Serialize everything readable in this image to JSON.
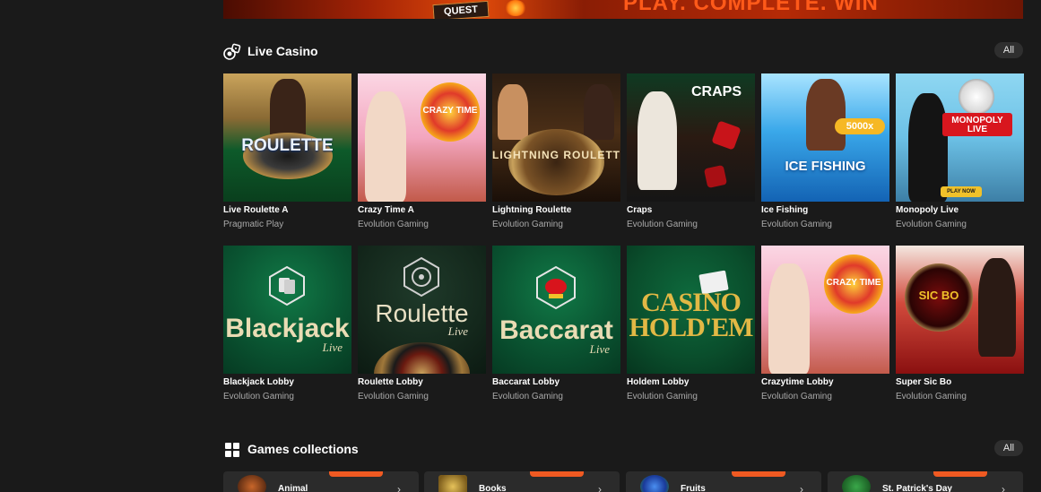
{
  "banner": {
    "badge": "QUEST",
    "slogan": "PLAY. COMPLETE. WIN"
  },
  "live_casino": {
    "title": "Live Casino",
    "icon": "chips-dice-icon",
    "all_label": "All",
    "games": [
      {
        "name": "Live Roulette A",
        "provider": "Pragmatic Play",
        "art": "ROULETTE"
      },
      {
        "name": "Crazy Time A",
        "provider": "Evolution Gaming",
        "art": "CRAZY TIME"
      },
      {
        "name": "Lightning Roulette",
        "provider": "Evolution Gaming",
        "art": "LIGHTNING ROULETTE"
      },
      {
        "name": "Craps",
        "provider": "Evolution Gaming",
        "art": "CRAPS"
      },
      {
        "name": "Ice Fishing",
        "provider": "Evolution Gaming",
        "art": "ICE FISHING"
      },
      {
        "name": "Monopoly Live",
        "provider": "Evolution Gaming",
        "art": "MONOPOLY LIVE"
      },
      {
        "name": "Blackjack Lobby",
        "provider": "Evolution Gaming",
        "art": "Blackjack"
      },
      {
        "name": "Roulette Lobby",
        "provider": "Evolution Gaming",
        "art": "Roulette"
      },
      {
        "name": "Baccarat Lobby",
        "provider": "Evolution Gaming",
        "art": "Baccarat"
      },
      {
        "name": "Holdem Lobby",
        "provider": "Evolution Gaming",
        "art": "CASINO HOLD'EM"
      },
      {
        "name": "Crazytime Lobby",
        "provider": "Evolution Gaming",
        "art": "CRAZY TIME"
      },
      {
        "name": "Super Sic Bo",
        "provider": "Evolution Gaming",
        "art": "SIC BO"
      }
    ]
  },
  "collections": {
    "title": "Games collections",
    "icon": "grid-icon",
    "all_label": "All",
    "tiles": [
      {
        "label": "Animal",
        "icon": "animal-icon"
      },
      {
        "label": "Books",
        "icon": "book-icon"
      },
      {
        "label": "Fruits",
        "icon": "fruit-icon"
      },
      {
        "label": "St. Patrick's Day",
        "icon": "leprechaun-icon"
      }
    ]
  },
  "colors": {
    "background": "#1a1a1a",
    "accent": "#f05a22",
    "muted_text": "#a9a9a9"
  }
}
